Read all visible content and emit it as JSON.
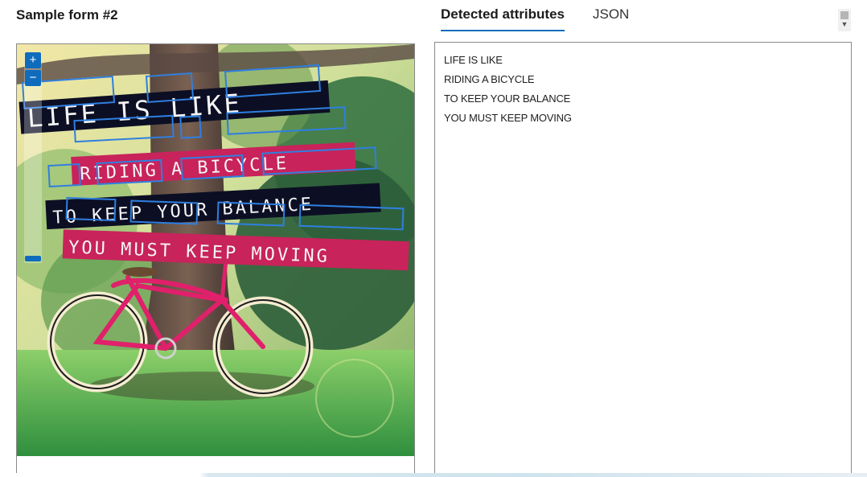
{
  "form": {
    "title": "Sample form #2"
  },
  "tabs": [
    {
      "label": "Detected attributes",
      "active": true
    },
    {
      "label": "JSON",
      "active": false
    }
  ],
  "image": {
    "banners": [
      {
        "words": [
          "LIFE",
          "IS",
          "LIKE"
        ],
        "color": "#0c0f24"
      },
      {
        "words": [
          "RIDING",
          "A",
          "BICYCLE"
        ],
        "color": "#c8235b"
      },
      {
        "words": [
          "TO",
          "KEEP",
          "YOUR",
          "BALANCE"
        ],
        "color": "#0c0f24"
      },
      {
        "words": [
          "YOU",
          "MUST",
          "KEEP",
          "MOVING"
        ],
        "color": "#c8235b"
      }
    ]
  },
  "zoom": {
    "in_label": "+",
    "out_label": "−"
  },
  "detected": {
    "lines": [
      "LIFE IS LIKE",
      "RIDING A BICYCLE",
      "TO KEEP YOUR BALANCE",
      "YOU MUST KEEP MOVING"
    ]
  },
  "colors": {
    "accent": "#0f6cbd",
    "highlight_box": "#2f7fe0",
    "bicycle": "#e0206a"
  },
  "icons": {
    "scroll_arrow": "chevron-down-icon"
  }
}
